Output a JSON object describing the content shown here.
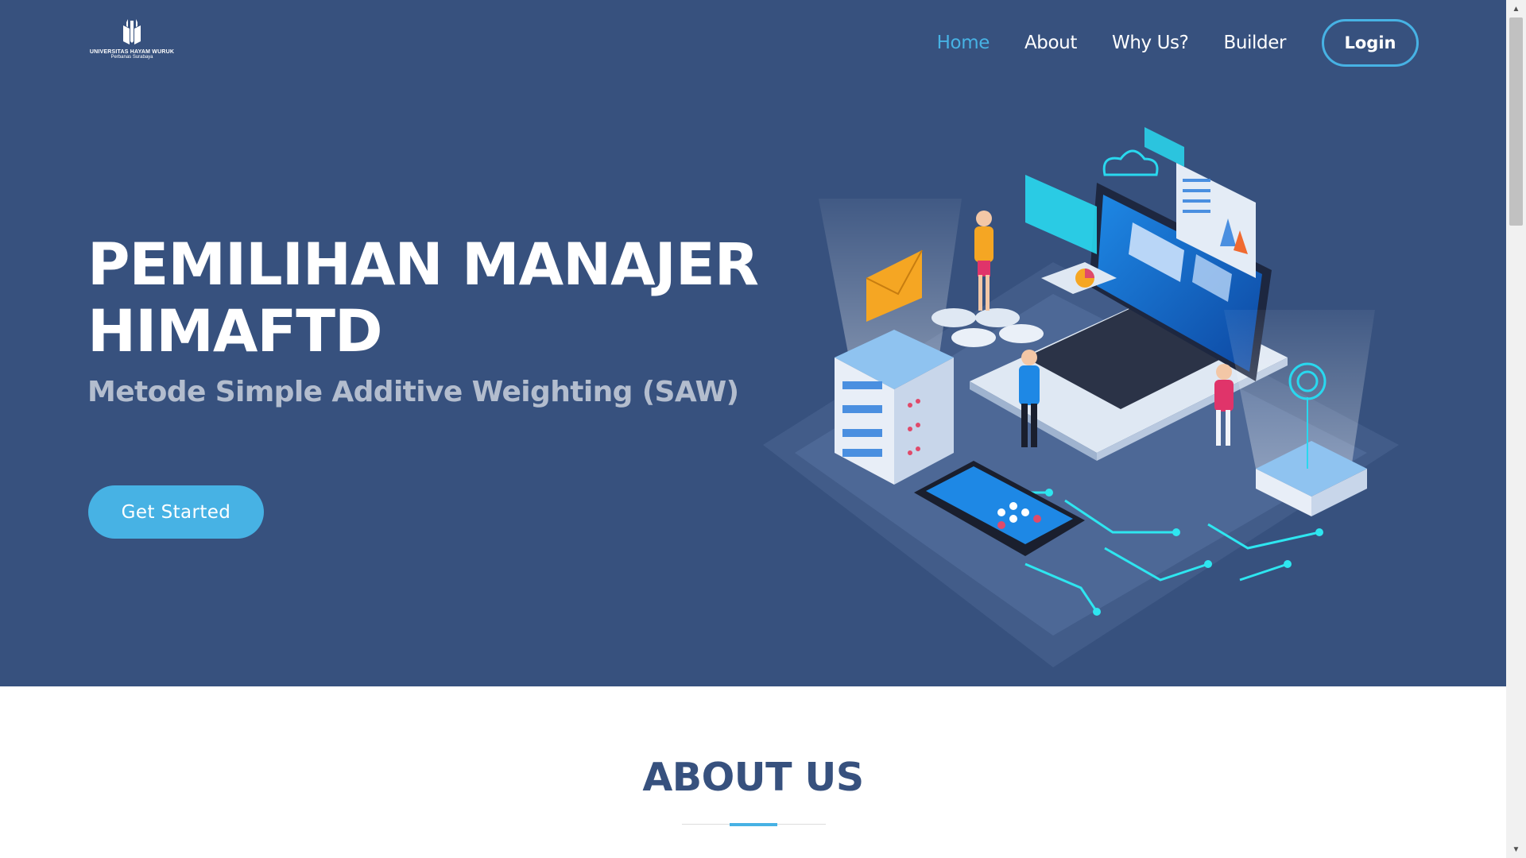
{
  "brand": {
    "logo_line1": "UNIVERSITAS HAYAM WURUK",
    "logo_line2": "Perbanas Surabaya"
  },
  "nav": {
    "items": [
      {
        "label": "Home",
        "active": true
      },
      {
        "label": "About",
        "active": false
      },
      {
        "label": "Why Us?",
        "active": false
      },
      {
        "label": "Builder",
        "active": false
      }
    ],
    "login_label": "Login"
  },
  "hero": {
    "title_line1": "PEMILIHAN MANAJER",
    "title_line2": "HIMAFTD",
    "subtitle": "Metode Simple Additive Weighting (SAW)",
    "cta_label": "Get Started",
    "illustration_icon": "isometric-tech-illustration"
  },
  "about": {
    "title": "ABOUT US"
  },
  "colors": {
    "hero_bg": "#37517e",
    "accent": "#47b2e4",
    "heading": "#37517e"
  }
}
